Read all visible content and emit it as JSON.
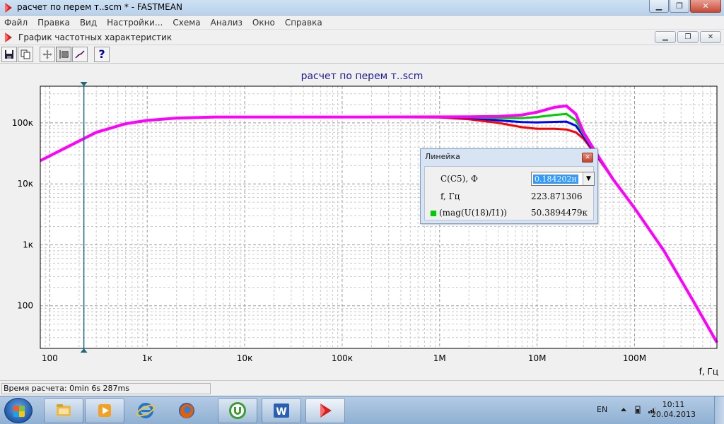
{
  "window": {
    "title": "расчет по перем т..scm * - FASTMEAN",
    "minimize": "0",
    "restore": "1",
    "close": "r"
  },
  "menu": [
    "Файл",
    "Правка",
    "Вид",
    "Настройки...",
    "Схема",
    "Анализ",
    "Окно",
    "Справка"
  ],
  "child_window": {
    "title": "График частотных характеристик"
  },
  "toolbar": {
    "help_label": "?"
  },
  "chart_data": {
    "type": "line",
    "title": "расчет по перем т..scm",
    "xlabel": "f, Гц",
    "ylabel": "",
    "x_scale": "log",
    "y_scale": "log",
    "xlim": [
      80,
      700000000
    ],
    "ylim": [
      20,
      400000
    ],
    "x_tick_labels": [
      "100",
      "1к",
      "10к",
      "100к",
      "1M",
      "10M",
      "100M"
    ],
    "x_tick_values": [
      100,
      1000,
      10000,
      100000,
      1000000,
      10000000,
      100000000
    ],
    "y_tick_labels": [
      "100",
      "1к",
      "10к",
      "100к"
    ],
    "y_tick_values": [
      100,
      1000,
      10000,
      100000
    ],
    "grid": true,
    "cursor_x": 223.871306,
    "series": [
      {
        "color": "#ff0000",
        "x": [
          80,
          150,
          300,
          600,
          1000,
          2000,
          5000,
          10000.0,
          100000.0,
          1000000.0,
          2000000.0,
          4000000.0,
          7000000.0,
          10000000.0,
          15000000.0,
          20000000.0,
          25000000.0,
          30000000.0,
          40000000.0,
          60000000.0,
          100000000.0,
          200000000.0,
          400000000.0,
          700000000.0
        ],
        "y": [
          24000,
          40000,
          70000,
          97000,
          110000,
          120000,
          125000,
          125000,
          125000,
          123000,
          115000,
          100000,
          85000,
          80000,
          80000,
          78000,
          70000,
          55000,
          30000,
          12000,
          4000,
          800,
          120,
          25
        ]
      },
      {
        "color": "#0000ff",
        "x": [
          80,
          150,
          300,
          600,
          1000,
          2000,
          5000,
          10000.0,
          100000.0,
          1000000.0,
          2000000.0,
          4000000.0,
          7000000.0,
          10000000.0,
          15000000.0,
          20000000.0,
          25000000.0,
          30000000.0,
          40000000.0,
          60000000.0,
          100000000.0,
          200000000.0,
          400000000.0,
          700000000.0
        ],
        "y": [
          24000,
          40000,
          70000,
          97000,
          110000,
          120000,
          125000,
          125000,
          125000,
          124500,
          121000,
          110000,
          103000,
          102000,
          104000,
          105000,
          90000,
          60000,
          31000,
          12000,
          4000,
          800,
          120,
          25
        ]
      },
      {
        "color": "#00cc00",
        "x": [
          80,
          150,
          300,
          600,
          1000,
          2000,
          5000,
          10000.0,
          100000.0,
          1000000.0,
          2000000.0,
          4000000.0,
          7000000.0,
          10000000.0,
          15000000.0,
          20000000.0,
          25000000.0,
          30000000.0,
          40000000.0,
          60000000.0,
          100000000.0,
          200000000.0,
          400000000.0,
          700000000.0
        ],
        "y": [
          24000,
          40000,
          70000,
          97000,
          110000,
          120000,
          125000,
          125000,
          125000,
          125000,
          124000,
          120000,
          120000,
          125000,
          135000,
          140000,
          110000,
          65000,
          32000,
          12000,
          4000,
          800,
          120,
          25
        ]
      },
      {
        "color": "#ff00ff",
        "x": [
          80,
          150,
          300,
          600,
          1000,
          2000,
          5000,
          10000.0,
          100000.0,
          1000000.0,
          2000000.0,
          4000000.0,
          7000000.0,
          10000000.0,
          15000000.0,
          20000000.0,
          25000000.0,
          30000000.0,
          40000000.0,
          60000000.0,
          100000000.0,
          200000000.0,
          400000000.0,
          700000000.0
        ],
        "y": [
          24000,
          40000,
          70000,
          97000,
          110000,
          120000,
          125000,
          125000,
          125000,
          125500,
          126000,
          128000,
          135000,
          150000,
          180000,
          190000,
          140000,
          70000,
          33000,
          12000,
          4000,
          800,
          120,
          25
        ]
      }
    ]
  },
  "ruler": {
    "title": "Линейка",
    "param_label": "C(C5), Ф",
    "param_value": "0.184202н",
    "f_label": "f, Гц",
    "f_value": "223.871306",
    "mag_label": "(mag(U(18)/I1))",
    "mag_value": "50.3894479к",
    "mag_color": "#00cc00",
    "close": "x"
  },
  "status": {
    "calc_time": "Время расчета: 0min 6s 287ms"
  },
  "taskbar": {
    "lang": "EN",
    "time": "10:11",
    "date": "20.04.2013",
    "apps": [
      "explorer",
      "media-player",
      "internet-explorer",
      "firefox",
      "utorrent",
      "word",
      "fastmean"
    ]
  }
}
